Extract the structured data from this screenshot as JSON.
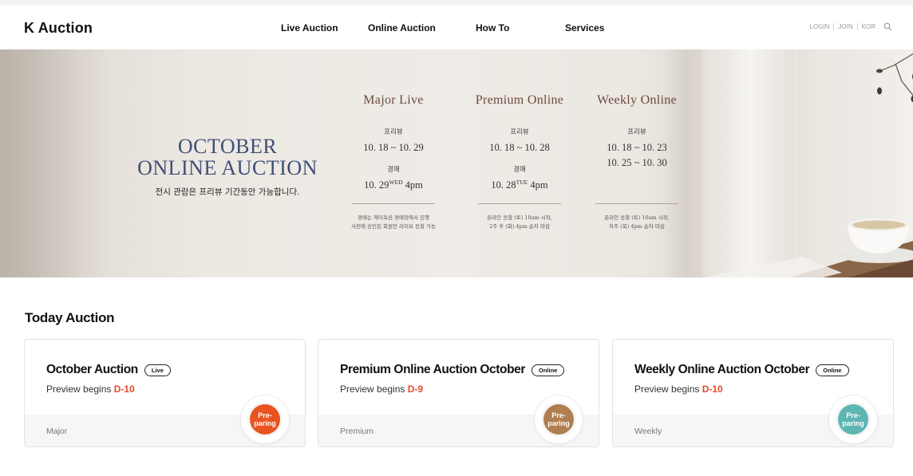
{
  "header": {
    "logo": "K Auction",
    "nav": [
      "Live Auction",
      "Online Auction",
      "How To",
      "Services"
    ],
    "util": {
      "login": "LOGIN",
      "join": "JOIN",
      "lang": "KOR",
      "search_icon": "search-icon"
    }
  },
  "banner": {
    "title_line1": "OCTOBER",
    "title_line2": "ONLINE AUCTION",
    "subtitle": "전시 관람은 프리뷰 기간동안 가능합니다.",
    "columns": [
      {
        "title": "Major Live",
        "preview_label": "프리뷰",
        "preview_dates": "10. 18 ~ 10. 29",
        "auction_label": "경매",
        "auction_date": "10. 29",
        "auction_day": "WED",
        "auction_time": "4pm",
        "note_line1": "경매는 케이옥션 경매장에서 진행",
        "note_line2": "사전에 승인된 회원만 라이브 응찰 가능"
      },
      {
        "title": "Premium Online",
        "preview_label": "프리뷰",
        "preview_dates": "10. 18 ~ 10. 28",
        "auction_label": "경매",
        "auction_date": "10. 28",
        "auction_day": "TUE",
        "auction_time": "4pm",
        "note_line1": "온라인 응찰 (토) 10am 시작,",
        "note_line2": "2주 후 (화) 4pm 순차 마감"
      },
      {
        "title": "Weekly Online",
        "preview_label": "프리뷰",
        "preview_dates_1": "10. 18 ~ 10. 23",
        "preview_dates_2": "10. 25 ~ 10. 30",
        "note_line1": "온라인 응찰 (토) 10am 시작,",
        "note_line2": "차주 (목) 4pm 순차 마감"
      }
    ]
  },
  "today": {
    "title": "Today Auction",
    "cards": [
      {
        "title": "October Auction",
        "tag": "Live",
        "preview_prefix": "Preview begins",
        "dday": "D-10",
        "category": "Major",
        "badge_line1": "Pre-",
        "badge_line2": "paring",
        "badge_color": "#e8541f"
      },
      {
        "title": "Premium Online Auction October",
        "tag": "Online",
        "preview_prefix": "Preview begins",
        "dday": "D-9",
        "category": "Premium",
        "badge_line1": "Pre-",
        "badge_line2": "paring",
        "badge_color": "#b07f4f"
      },
      {
        "title": "Weekly Online Auction October",
        "tag": "Online",
        "preview_prefix": "Preview begins",
        "dday": "D-10",
        "category": "Weekly",
        "badge_line1": "Pre-",
        "badge_line2": "paring",
        "badge_color": "#5db6b3"
      }
    ]
  },
  "colors": {
    "accent_red": "#e8492a",
    "banner_title": "#3f4e77",
    "column_title": "#6b4a3e"
  }
}
